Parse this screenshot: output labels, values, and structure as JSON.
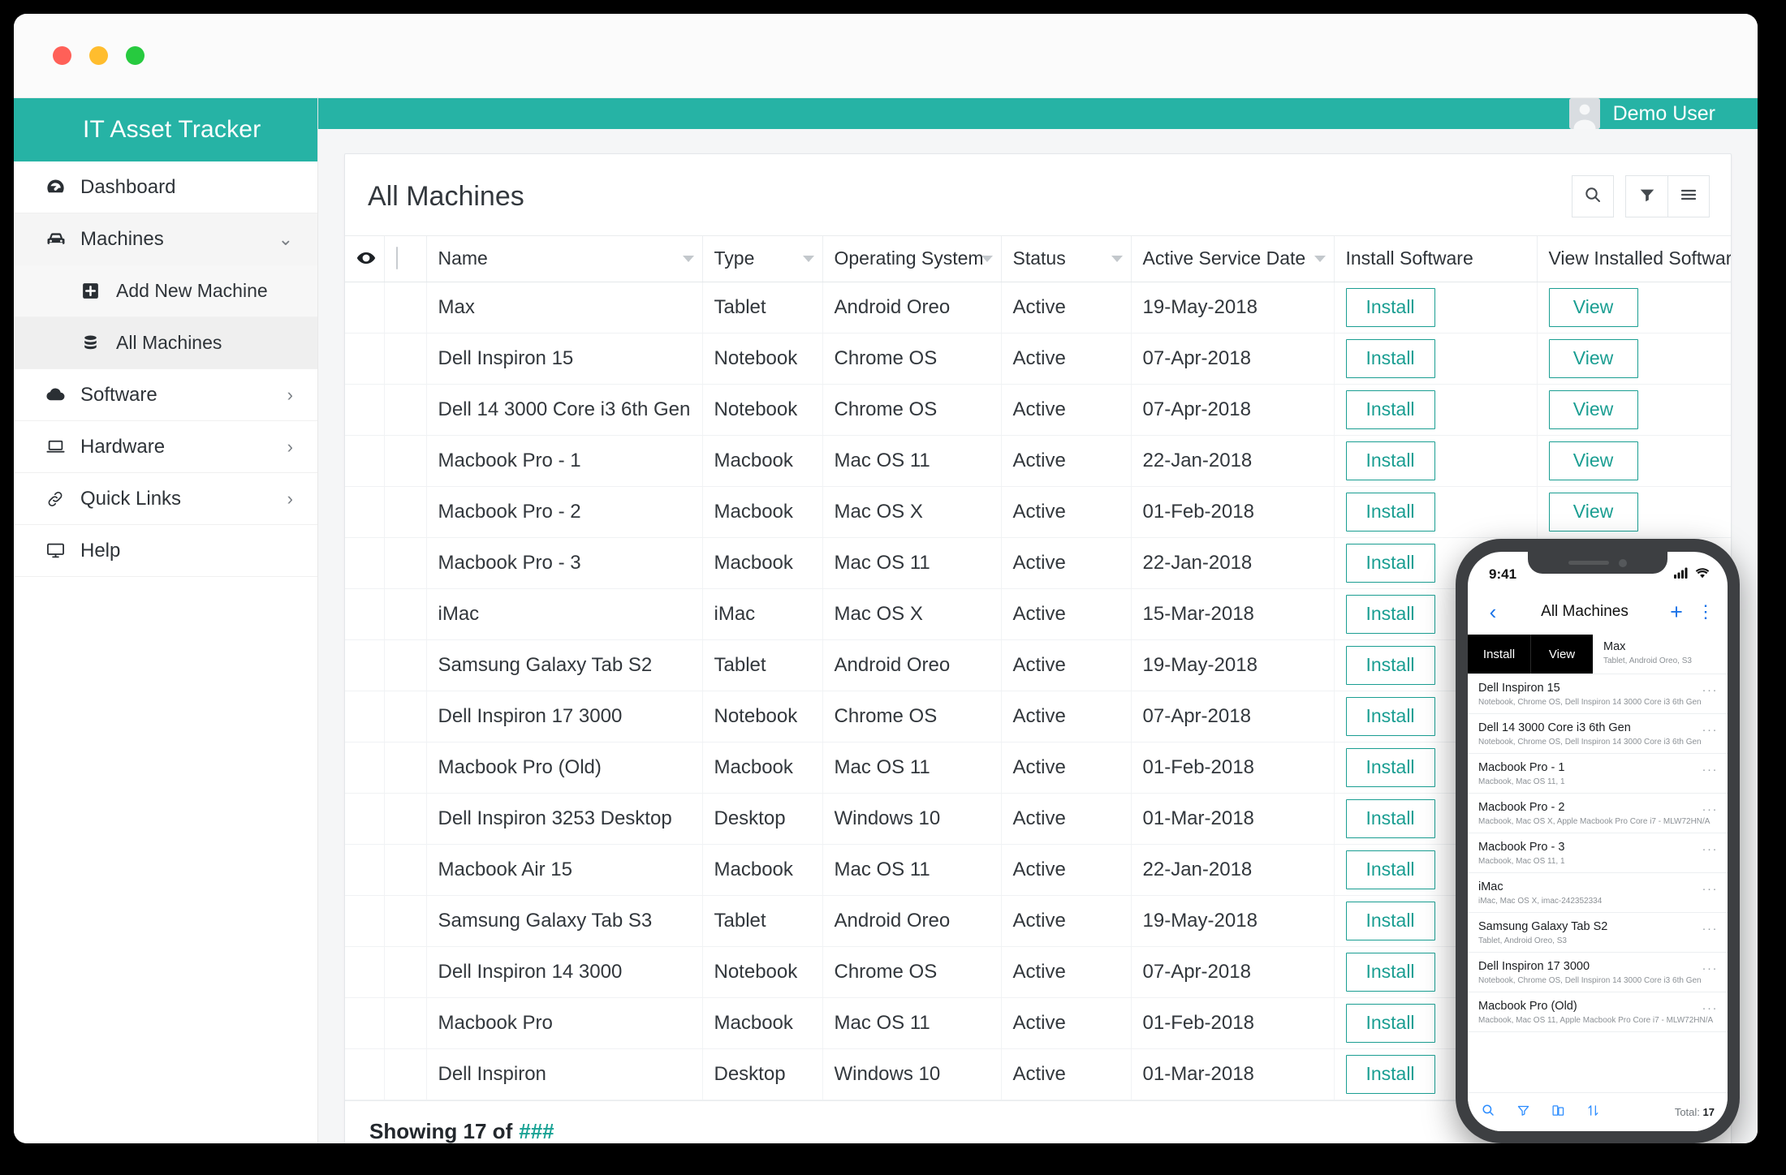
{
  "window": {
    "traffic_lights": [
      "close",
      "minimize",
      "maximize"
    ]
  },
  "sidebar": {
    "brand": "IT Asset Tracker",
    "items": [
      {
        "label": "Dashboard",
        "icon": "dashboard-icon",
        "chevron": ""
      },
      {
        "label": "Machines",
        "icon": "machines-icon",
        "chevron": "⌄"
      },
      {
        "label": "Software",
        "icon": "cloud-icon",
        "chevron": "›"
      },
      {
        "label": "Hardware",
        "icon": "laptop-icon",
        "chevron": "›"
      },
      {
        "label": "Quick Links",
        "icon": "link-icon",
        "chevron": "›"
      },
      {
        "label": "Help",
        "icon": "monitor-icon",
        "chevron": ""
      }
    ],
    "sub_items": [
      {
        "label": "Add New Machine",
        "icon": "plus-square-icon"
      },
      {
        "label": "All Machines",
        "icon": "database-icon"
      }
    ]
  },
  "topbar": {
    "user_name": "Demo User",
    "avatar_icon": "user-avatar-icon"
  },
  "main": {
    "title": "All Machines",
    "actions": [
      {
        "name": "search-icon",
        "label": "Search"
      },
      {
        "name": "filter-icon",
        "label": "Filter"
      },
      {
        "name": "menu-icon",
        "label": "Menu"
      }
    ],
    "footer_prefix": "Showing 17 of",
    "footer_count": "###"
  },
  "table": {
    "columns": [
      {
        "key": "eye",
        "label": "",
        "icon": "eye-icon",
        "sortable": false
      },
      {
        "key": "select",
        "label": "",
        "icon": "checkbox-icon",
        "sortable": false
      },
      {
        "key": "name",
        "label": "Name",
        "sortable": true
      },
      {
        "key": "type",
        "label": "Type",
        "sortable": true
      },
      {
        "key": "os",
        "label": "Operating System",
        "sortable": true
      },
      {
        "key": "status",
        "label": "Status",
        "sortable": true
      },
      {
        "key": "date",
        "label": "Active Service Date",
        "sortable": true
      },
      {
        "key": "install",
        "label": "Install Software",
        "sortable": false
      },
      {
        "key": "view",
        "label": "View Installed Softwares",
        "sortable": false
      }
    ],
    "install_label": "Install",
    "view_label": "View",
    "rows": [
      {
        "name": "Max",
        "type": "Tablet",
        "os": "Android Oreo",
        "status": "Active",
        "date": "19-May-2018"
      },
      {
        "name": "Dell Inspiron 15",
        "type": "Notebook",
        "os": "Chrome OS",
        "status": "Active",
        "date": "07-Apr-2018"
      },
      {
        "name": "Dell 14 3000 Core i3 6th Gen",
        "type": "Notebook",
        "os": "Chrome OS",
        "status": "Active",
        "date": "07-Apr-2018"
      },
      {
        "name": "Macbook Pro - 1",
        "type": "Macbook",
        "os": "Mac OS 11",
        "status": "Active",
        "date": "22-Jan-2018"
      },
      {
        "name": "Macbook Pro - 2",
        "type": "Macbook",
        "os": "Mac OS X",
        "status": "Active",
        "date": "01-Feb-2018"
      },
      {
        "name": "Macbook Pro - 3",
        "type": "Macbook",
        "os": "Mac OS 11",
        "status": "Active",
        "date": "22-Jan-2018"
      },
      {
        "name": "iMac",
        "type": "iMac",
        "os": "Mac OS X",
        "status": "Active",
        "date": "15-Mar-2018"
      },
      {
        "name": "Samsung Galaxy Tab S2",
        "type": "Tablet",
        "os": "Android Oreo",
        "status": "Active",
        "date": "19-May-2018"
      },
      {
        "name": "Dell Inspiron 17 3000",
        "type": "Notebook",
        "os": "Chrome OS",
        "status": "Active",
        "date": "07-Apr-2018"
      },
      {
        "name": "Macbook Pro (Old)",
        "type": "Macbook",
        "os": "Mac OS 11",
        "status": "Active",
        "date": "01-Feb-2018"
      },
      {
        "name": "Dell Inspiron 3253 Desktop",
        "type": "Desktop",
        "os": "Windows 10",
        "status": "Active",
        "date": "01-Mar-2018"
      },
      {
        "name": "Macbook Air 15",
        "type": "Macbook",
        "os": "Mac OS 11",
        "status": "Active",
        "date": "22-Jan-2018"
      },
      {
        "name": "Samsung Galaxy Tab S3",
        "type": "Tablet",
        "os": "Android Oreo",
        "status": "Active",
        "date": "19-May-2018"
      },
      {
        "name": "Dell Inspiron 14 3000",
        "type": "Notebook",
        "os": "Chrome OS",
        "status": "Active",
        "date": "07-Apr-2018"
      },
      {
        "name": "Macbook Pro",
        "type": "Macbook",
        "os": "Mac OS 11",
        "status": "Active",
        "date": "01-Feb-2018"
      },
      {
        "name": "Dell Inspiron",
        "type": "Desktop",
        "os": "Windows 10",
        "status": "Active",
        "date": "01-Mar-2018"
      }
    ]
  },
  "phone": {
    "status_time": "9:41",
    "signal_icon": "cellular-signal-icon",
    "wifi_icon": "wifi-icon",
    "back_icon": "‹",
    "title": "All Machines",
    "add_icon": "+",
    "more_icon": "⋮",
    "swipe": {
      "install_label": "Install",
      "view_label": "View",
      "title": "Max",
      "sub": "Tablet, Android Oreo, S3"
    },
    "items": [
      {
        "title": "Dell Inspiron 15",
        "sub": "Notebook, Chrome OS,  Dell Inspiron 14 3000 Core i3 6th Gen"
      },
      {
        "title": "Dell 14 3000 Core i3 6th Gen",
        "sub": "Notebook, Chrome OS,  Dell Inspiron 14 3000 Core i3 6th Gen"
      },
      {
        "title": "Macbook Pro - 1",
        "sub": "Macbook,  Mac OS 11, 1"
      },
      {
        "title": "Macbook Pro - 2",
        "sub": "Macbook, Mac OS X, Apple Macbook Pro Core i7 - MLW72HN/A"
      },
      {
        "title": "Macbook Pro - 3",
        "sub": "Macbook,  Mac OS 11, 1"
      },
      {
        "title": "iMac",
        "sub": "iMac, Mac OS X, imac-242352334"
      },
      {
        "title": "Samsung Galaxy Tab S2",
        "sub": "Tablet, Android Oreo, S3"
      },
      {
        "title": "Dell Inspiron 17 3000",
        "sub": "Notebook, Chrome OS,  Dell Inspiron 14 3000 Core i3 6th Gen"
      },
      {
        "title": "Macbook Pro (Old)",
        "sub": "Macbook,  Mac OS 11, Apple Macbook Pro Core i7 - MLW72HN/A"
      }
    ],
    "item_more_icon": "···",
    "toolbar": [
      {
        "name": "search-icon"
      },
      {
        "name": "filter-icon"
      },
      {
        "name": "copy-icon"
      },
      {
        "name": "sort-icon"
      }
    ],
    "total_label": "Total:",
    "total_value": "17"
  },
  "colors": {
    "brand_teal": "#26b3a5",
    "button_teal": "#1a9e92",
    "phone_blue": "#2b8cff"
  }
}
